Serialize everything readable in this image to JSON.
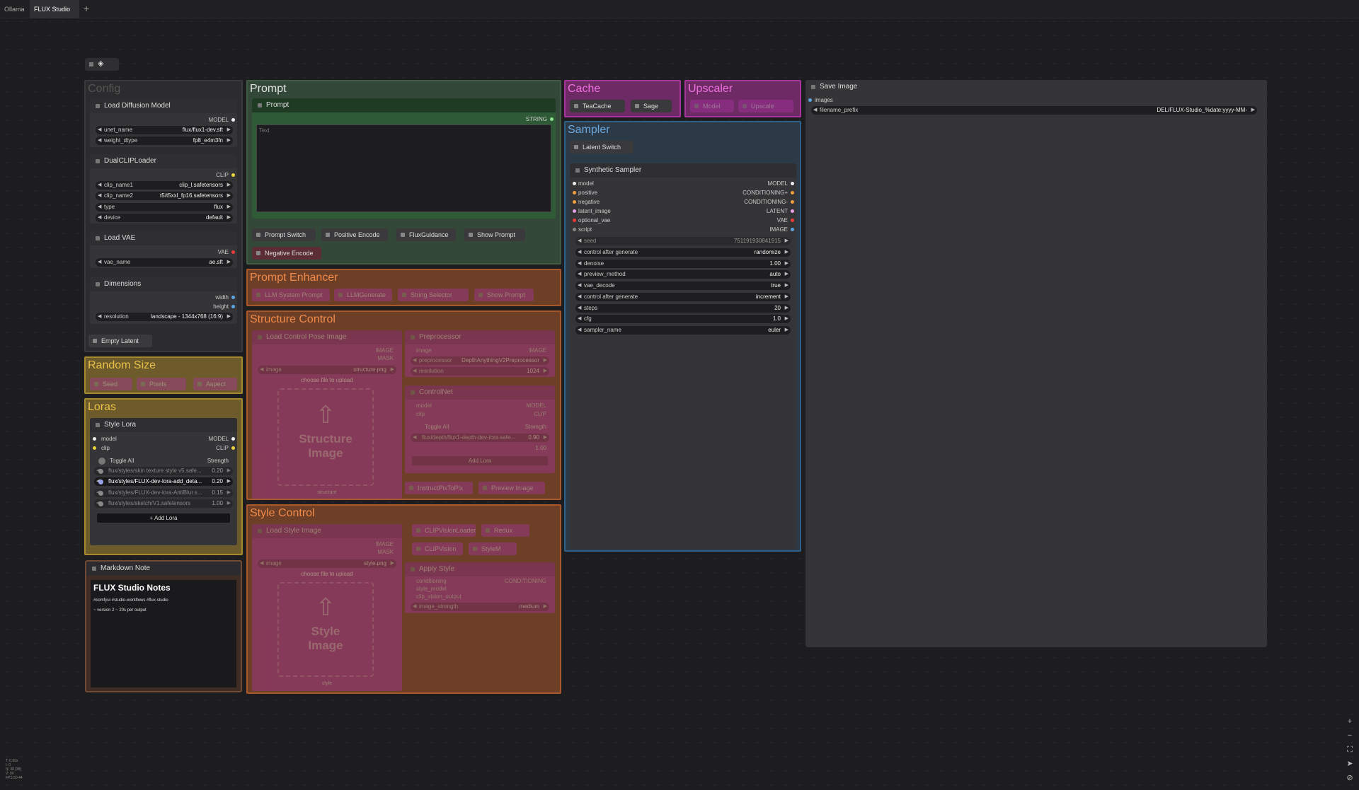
{
  "tabs": [
    "Ollama",
    "FLUX Studio"
  ],
  "groups": {
    "config": "Config",
    "prompt": "Prompt",
    "cache": "Cache",
    "upscaler": "Upscaler",
    "sampler": "Sampler",
    "prompt_enhancer": "Prompt Enhancer",
    "structure_control": "Structure Control",
    "style_control": "Style Control",
    "random_size": "Random Size",
    "loras": "Loras"
  },
  "config": {
    "diffusion": {
      "title": "Load Diffusion Model",
      "out": "MODEL",
      "unet_label": "unet_name",
      "unet_value": "flux/flux1-dev.sft",
      "dtype_label": "weight_dtype",
      "dtype_value": "fp8_e4m3fn"
    },
    "clip": {
      "title": "DualCLIPLoader",
      "out": "CLIP",
      "c1_label": "clip_name1",
      "c1_value": "clip_l.safetensors",
      "c2_label": "clip_name2",
      "c2_value": "t5/t5xxl_fp16.safetensors",
      "type_label": "type",
      "type_value": "flux",
      "device_label": "device",
      "device_value": "default"
    },
    "vae": {
      "title": "Load VAE",
      "out": "VAE",
      "label": "vae_name",
      "value": "ae.sft"
    },
    "dims": {
      "title": "Dimensions",
      "out1": "width",
      "out2": "height",
      "res_label": "resolution",
      "res_value": "landscape - 1344x768 (16:9)"
    },
    "empty_latent": "Empty Latent"
  },
  "random_size": {
    "seed": "Seed",
    "pixels": "Pixels",
    "aspect": "Aspect"
  },
  "loras": {
    "title": "Style Lora",
    "in_model": "model",
    "in_clip": "clip",
    "out_model": "MODEL",
    "out_clip": "CLIP",
    "toggle_all": "Toggle All",
    "strength": "Strength",
    "items": [
      {
        "name": "flux/styles/skin texture style v5.safe...",
        "value": "0.20"
      },
      {
        "name": "flux/styles/FLUX-dev-lora-add_deta...",
        "value": "0.20"
      },
      {
        "name": "flux/styles/FLUX-dev-lora-AntiBlur.s...",
        "value": "0.15"
      },
      {
        "name": "flux/styles/sketch/V1.safetensors",
        "value": "1.00"
      }
    ],
    "add_button": "Add Lora"
  },
  "note": {
    "title": "Markdown Note",
    "heading": "FLUX Studio Notes",
    "tags": "#comfyui #studio-workflows #flux-studio",
    "line": "~ version 2 ~ 20s per output"
  },
  "prompt": {
    "node_title": "Prompt",
    "out": "STRING",
    "placeholder": "Text",
    "chips": [
      "Prompt Switch",
      "Positive Encode",
      "FluxGuidance",
      "Show Prompt",
      "Negative Encode"
    ]
  },
  "enhancer": {
    "chips": [
      "LLM System Prompt",
      "LLMGenerate",
      "String Selector",
      "Show Prompt"
    ]
  },
  "structure": {
    "load": {
      "title": "Load Control Pose Image",
      "out1": "IMAGE",
      "out2": "MASK",
      "image_label": "image",
      "image_value": "structure.png",
      "choose": "choose file to upload",
      "upload_text1": "Structure",
      "upload_text2": "Image",
      "footer": "structure"
    },
    "pre": {
      "title": "Preprocessor",
      "in": "image",
      "out": "IMAGE",
      "w1_label": "preprocessor",
      "w1_value": "DepthAnythingV2Preprocessor",
      "w2_label": "resolution",
      "w2_value": "1024"
    },
    "cn": {
      "title": "ControlNet",
      "in1": "model",
      "in2": "clip",
      "out1": "MODEL",
      "out2": "CLIP",
      "toggle": "Toggle All",
      "strength": "Strength",
      "lora_name": "flux/depth/flux1-depth-dev-lora.safe...",
      "lora_value": "0.90",
      "lora_extra": "1.00",
      "add": "Add Lora"
    },
    "chips": [
      "InstructPixToPix",
      "Preview Image"
    ]
  },
  "style": {
    "load": {
      "title": "Load Style Image",
      "out1": "IMAGE",
      "out2": "MASK",
      "image_label": "image",
      "image_value": "style.png",
      "choose": "choose file to upload",
      "upload_text1": "Style",
      "upload_text2": "Image",
      "footer": "style"
    },
    "chips1": [
      "CLIPVisionLoader",
      "Redux"
    ],
    "chips2": [
      "CLIPVision",
      "StyleM"
    ],
    "apply": {
      "title": "Apply Style",
      "in1": "conditioning",
      "in2": "style_model",
      "in3": "clip_vision_output",
      "out": "CONDITIONING",
      "w_label": "image_strength",
      "w_value": "medium"
    }
  },
  "cache": {
    "chips": [
      "TeaCache",
      "Sage"
    ]
  },
  "upscaler": {
    "chips": [
      "Model",
      "Upscale"
    ]
  },
  "sampler": {
    "latent_switch": "Latent Switch",
    "title": "Synthetic Sampler",
    "rows": [
      {
        "in": "model",
        "out": "MODEL"
      },
      {
        "in": "positive",
        "out": "CONDITIONING+"
      },
      {
        "in": "negative",
        "out": "CONDITIONING-"
      },
      {
        "in": "latent_image",
        "out": "LATENT"
      },
      {
        "in": "optional_vae",
        "out": "VAE"
      },
      {
        "in": "script",
        "out": "IMAGE"
      }
    ],
    "seed_label": "seed",
    "seed_value": "751191930841915",
    "widgets": [
      {
        "label": "control after generate",
        "value": "randomize"
      },
      {
        "label": "denoise",
        "value": "1.00"
      },
      {
        "label": "preview_method",
        "value": "auto"
      },
      {
        "label": "vae_decode",
        "value": "true"
      },
      {
        "label": "control after generate",
        "value": "increment"
      },
      {
        "label": "steps",
        "value": "20"
      },
      {
        "label": "cfg",
        "value": "1.0"
      },
      {
        "label": "sampler_name",
        "value": "euler"
      }
    ]
  },
  "save_image": {
    "title": "Save Image",
    "in": "images",
    "prefix_label": "filename_prefix",
    "prefix_value": "DEL/FLUX-Studio_%date:yyyy-MM-"
  },
  "stats": [
    "T: 0.00s",
    "I: 0",
    "N: 38 [38]",
    "V: 90",
    "FPS:50.44"
  ],
  "colors": {
    "config": "#3a3a3c",
    "prompt": "#3f5c43",
    "purple": "#a8359e",
    "sampler": "#2f628a",
    "orange": "#a9582c",
    "yellow": "#a6882d",
    "brown": "#704a35"
  }
}
